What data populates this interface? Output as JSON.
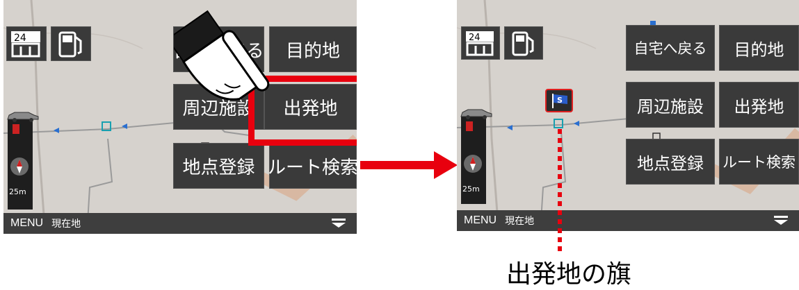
{
  "left_screen": {
    "buttons": {
      "home": "自宅へ戻る",
      "destination": "目的地",
      "nearby": "周辺施設",
      "departure": "出発地",
      "register": "地点登録",
      "route_search": "ルート検索"
    },
    "bottom_bar": {
      "menu": "MENU",
      "location": "現在地"
    },
    "scale": "25m",
    "store_icon_label": "24"
  },
  "right_screen": {
    "buttons": {
      "home": "自宅へ戻る",
      "destination": "目的地",
      "nearby": "周辺施設",
      "departure": "出発地",
      "register": "地点登録",
      "route_search": "ルート検索"
    },
    "bottom_bar": {
      "menu": "MENU",
      "location": "現在地"
    },
    "scale": "25m",
    "store_icon_label": "24",
    "flag_label": "S"
  },
  "caption": "出発地の旗",
  "colors": {
    "highlight": "#e8000e",
    "tile": "#3a3a3a",
    "map": "#d6d2cd"
  },
  "icons": [
    "convenience-store-icon",
    "gas-station-icon",
    "car-icon",
    "compass-icon",
    "chevron-down-icon",
    "pointing-hand-icon",
    "start-flag-icon"
  ]
}
